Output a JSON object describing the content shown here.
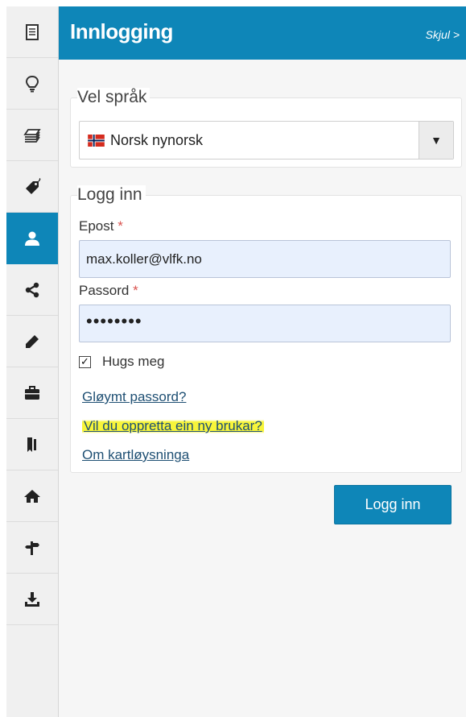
{
  "colors": {
    "accent": "#0e86b8",
    "input_bg": "#e8f0fd",
    "highlight": "#f7f53a",
    "required": "#d9534f"
  },
  "rail": {
    "items": [
      {
        "icon": "document-icon",
        "active": false
      },
      {
        "icon": "lightbulb-icon",
        "active": false
      },
      {
        "icon": "layers-icon",
        "active": false
      },
      {
        "icon": "tag-icon",
        "active": false
      },
      {
        "icon": "user-icon",
        "active": true
      },
      {
        "icon": "share-icon",
        "active": false
      },
      {
        "icon": "pencil-icon",
        "active": false
      },
      {
        "icon": "briefcase-icon",
        "active": false
      },
      {
        "icon": "bookmark-icon",
        "active": false
      },
      {
        "icon": "home-icon",
        "active": false
      },
      {
        "icon": "signpost-icon",
        "active": false
      },
      {
        "icon": "download-icon",
        "active": false
      }
    ]
  },
  "header": {
    "title": "Innlogging",
    "hide_label": "Skjul >"
  },
  "language": {
    "legend": "Vel språk",
    "selected": "Norsk nynorsk",
    "flag_icon": "norway-flag-icon"
  },
  "login": {
    "legend": "Logg inn",
    "email_label": "Epost",
    "email_value": "max.koller@vlfk.no",
    "password_label": "Passord",
    "password_value": "••••••••",
    "required_mark": "*",
    "remember_label": "Hugs meg",
    "remember_checked": true,
    "forgot_link": "Gløymt passord?",
    "create_link": "Vil du oppretta ein ny brukar?",
    "about_link": "Om kartløysninga",
    "submit_label": "Logg inn"
  }
}
